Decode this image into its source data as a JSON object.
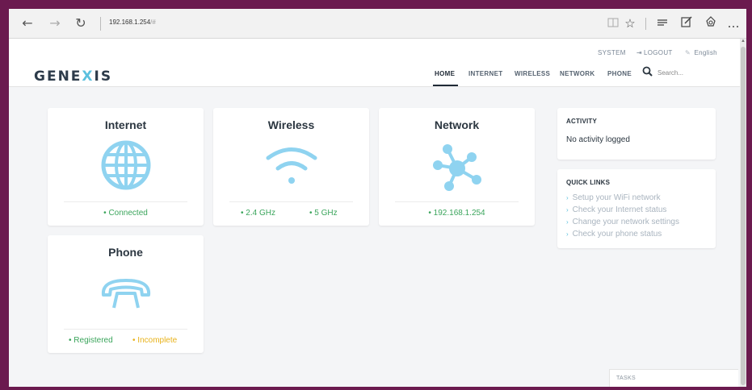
{
  "browser": {
    "back": "←",
    "forward": "→",
    "refresh": "↻",
    "address": "192.168.1.254",
    "address_hash": "/#",
    "tools": {
      "reading_view": "reading-view-icon",
      "favorites": "star-icon",
      "hub": "hub-icon",
      "notes": "web-note-icon",
      "share": "share-icon",
      "more": "…"
    }
  },
  "header": {
    "logo_part1": "GENE",
    "logo_x": "X",
    "logo_part2": "IS",
    "system": "SYSTEM",
    "logout": "LOGOUT",
    "language": "English",
    "menu": [
      "HOME",
      "INTERNET",
      "WIRELESS",
      "NETWORK",
      "PHONE"
    ],
    "active_menu": "HOME",
    "search_placeholder": "Search..."
  },
  "cards": {
    "internet": {
      "title": "Internet",
      "status": "Connected"
    },
    "wireless": {
      "title": "Wireless",
      "status_24": "2.4 GHz",
      "status_5": "5 GHz"
    },
    "network": {
      "title": "Network",
      "status": "192.168.1.254"
    },
    "phone": {
      "title": "Phone",
      "status_registered": "Registered",
      "status_incomplete": "Incomplete"
    }
  },
  "status_dot": "•",
  "sidebar": {
    "activity_title": "ACTIVITY",
    "activity_text": "No activity logged",
    "quicklinks_title": "QUICK LINKS",
    "quicklinks": [
      "Setup your WiFi network",
      "Check your Internet status",
      "Change your network settings",
      "Check your phone status"
    ]
  },
  "tasks_label": "TASKS",
  "colors": {
    "accent": "#5bc0de",
    "status_ok": "#3ba55c",
    "status_warn": "#e8b21a",
    "frame": "#6b1a4f",
    "icon": "#8fd3f0"
  }
}
